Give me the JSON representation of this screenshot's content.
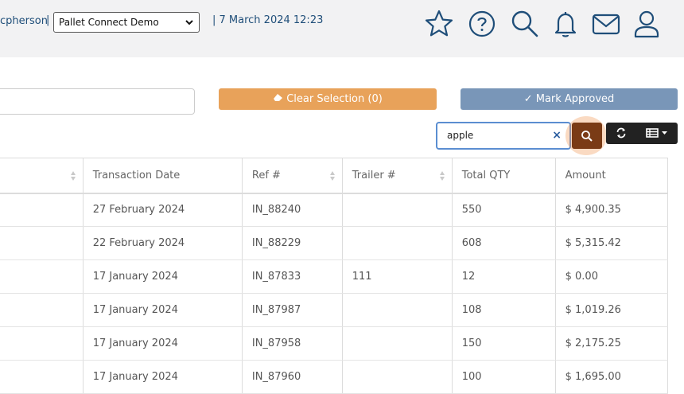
{
  "header": {
    "user_fragment": "cpherson",
    "separator": "|",
    "company_selected": "Pallet Connect Demo",
    "datetime": "| 7 March 2024 12:23",
    "icons": [
      "star-icon",
      "help-icon",
      "search-icon",
      "bell-icon",
      "mail-icon",
      "user-icon"
    ],
    "accent_color": "#1f4e79"
  },
  "toolbar": {
    "clear_selection_label": "Clear Selection (0)",
    "mark_approved_label": "✓ Mark Approved",
    "clear_color": "#e8a25a",
    "approve_color": "#7996b8"
  },
  "search": {
    "value": "apple",
    "clear_symbol": "×",
    "button_color": "#7a3b16"
  },
  "table": {
    "columns": [
      "Transaction Date",
      "Ref #",
      "Trailer #",
      "Total QTY",
      "Amount"
    ],
    "rows": [
      [
        "27 February 2024",
        "IN_88240",
        "",
        "550",
        "$ 4,900.35"
      ],
      [
        "22 February 2024",
        "IN_88229",
        "",
        "608",
        "$ 5,315.42"
      ],
      [
        "17 January 2024",
        "IN_87833",
        "111",
        "12",
        "$ 0.00"
      ],
      [
        "17 January 2024",
        "IN_87987",
        "",
        "108",
        "$ 1,019.26"
      ],
      [
        "17 January 2024",
        "IN_87958",
        "",
        "150",
        "$ 2,175.25"
      ],
      [
        "17 January 2024",
        "IN_87960",
        "",
        "100",
        "$ 1,695.00"
      ]
    ]
  }
}
